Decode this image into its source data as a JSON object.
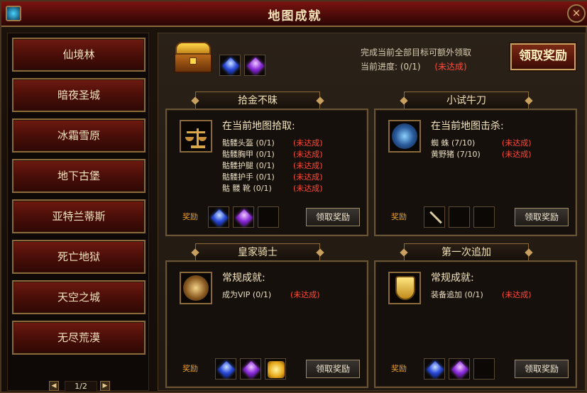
{
  "window": {
    "title": "地图成就"
  },
  "sidebar": {
    "items": [
      {
        "label": "仙境林"
      },
      {
        "label": "暗夜圣城"
      },
      {
        "label": "冰霜雪原"
      },
      {
        "label": "地下古堡"
      },
      {
        "label": "亚特兰蒂斯"
      },
      {
        "label": "死亡地狱"
      },
      {
        "label": "天空之城"
      },
      {
        "label": "无尽荒漠"
      }
    ],
    "pager": {
      "text": "1/2",
      "prev_icon": "prev-arrow-icon",
      "next_icon": "next-arrow-icon"
    }
  },
  "overview": {
    "description": "完成当前全部目标可额外领取",
    "progress_label": "当前进度: (0/1)",
    "progress_status": "(未达成)",
    "claim_label": "领取奖励",
    "rewards": [
      "blue-gem-icon",
      "purple-gem-icon"
    ]
  },
  "cards": [
    {
      "head": "拾金不昧",
      "title": "在当前地图拾取:",
      "icon": "scale-icon",
      "tasks": [
        {
          "name": "骷髅头盔 (0/1)",
          "status": "(未达成)"
        },
        {
          "name": "骷髅胸甲 (0/1)",
          "status": "(未达成)"
        },
        {
          "name": "骷髅护腿 (0/1)",
          "status": "(未达成)"
        },
        {
          "name": "骷髅护手 (0/1)",
          "status": "(未达成)"
        },
        {
          "name": "骷 髅 靴 (0/1)",
          "status": "(未达成)"
        }
      ],
      "reward_label": "奖励",
      "claim_label": "领取奖励",
      "rewards": [
        "blue-gem-icon",
        "purple-gem-icon",
        "empty-slot"
      ]
    },
    {
      "head": "小试牛刀",
      "title": "在当前地图击杀:",
      "icon": "spider-icon",
      "tasks": [
        {
          "name": "蜘   蛛 (7/10)",
          "status": "(未达成)"
        },
        {
          "name": "黄野猪 (7/10)",
          "status": "(未达成)"
        }
      ],
      "reward_label": "奖励",
      "claim_label": "领取奖励",
      "rewards": [
        "sword-icon",
        "empty-slot",
        "empty-slot"
      ]
    },
    {
      "head": "皇家骑士",
      "title": "常规成就:",
      "icon": "knight-icon",
      "tasks": [
        {
          "name": "成为VIP (0/1)",
          "status": "(未达成)"
        }
      ],
      "reward_label": "奖励",
      "claim_label": "领取奖励",
      "rewards": [
        "blue-gem-icon",
        "purple-gem-icon",
        "gold-item-icon"
      ]
    },
    {
      "head": "第一次追加",
      "title": "常规成就:",
      "icon": "shield-icon",
      "tasks": [
        {
          "name": "装备追加 (0/1)",
          "status": "(未达成)"
        }
      ],
      "reward_label": "奖励",
      "claim_label": "领取奖励",
      "rewards": [
        "blue-gem-icon",
        "purple-gem-icon",
        "empty-slot"
      ]
    }
  ],
  "colors": {
    "accent": "#c8a060",
    "incomplete": "#ff4a3a",
    "reward_label": "#e8a030"
  }
}
